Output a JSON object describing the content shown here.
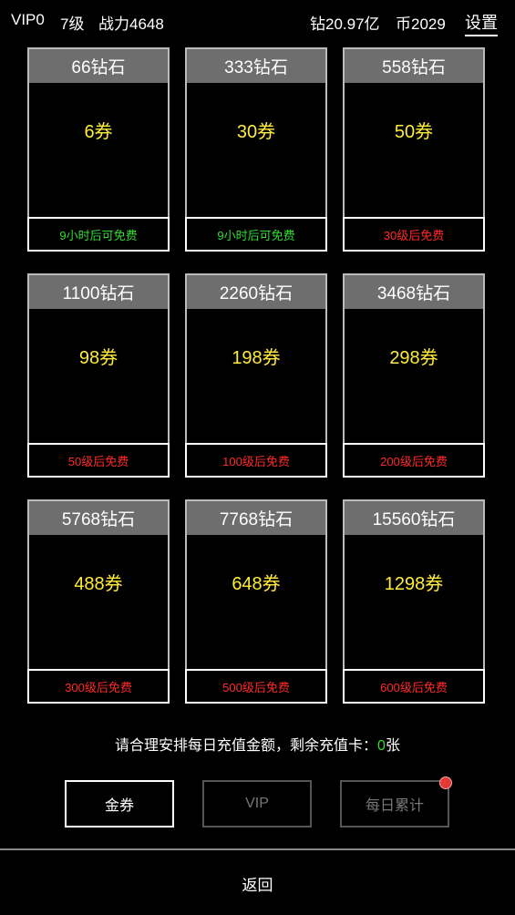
{
  "topbar": {
    "vip": "VIP0",
    "level": "7级",
    "power": "战力4648",
    "diamond": "钻20.97亿",
    "coin": "币2029",
    "settings": "设置"
  },
  "cards": [
    {
      "title": "66钻石",
      "price": "6券",
      "footer": "9小时后可免费",
      "footer_color": "green"
    },
    {
      "title": "333钻石",
      "price": "30券",
      "footer": "9小时后可免费",
      "footer_color": "green"
    },
    {
      "title": "558钻石",
      "price": "50券",
      "footer": "30级后免费",
      "footer_color": "red"
    },
    {
      "title": "1100钻石",
      "price": "98券",
      "footer": "50级后免费",
      "footer_color": "red"
    },
    {
      "title": "2260钻石",
      "price": "198券",
      "footer": "100级后免费",
      "footer_color": "red"
    },
    {
      "title": "3468钻石",
      "price": "298券",
      "footer": "200级后免费",
      "footer_color": "red"
    },
    {
      "title": "5768钻石",
      "price": "488券",
      "footer": "300级后免费",
      "footer_color": "red"
    },
    {
      "title": "7768钻石",
      "price": "648券",
      "footer": "500级后免费",
      "footer_color": "red"
    },
    {
      "title": "15560钻石",
      "price": "1298券",
      "footer": "600级后免费",
      "footer_color": "red"
    }
  ],
  "notice": {
    "prefix": "请合理安排每日充值金额，剩余充值卡：",
    "count": "0",
    "suffix": "张"
  },
  "tabs": {
    "gold": "金券",
    "vip": "VIP",
    "daily": "每日累计"
  },
  "back": "返回",
  "colors": {
    "green": "#33dd33",
    "red": "#ff2a2a",
    "price": "#ffeb3b",
    "header": "#6e6e6e"
  }
}
